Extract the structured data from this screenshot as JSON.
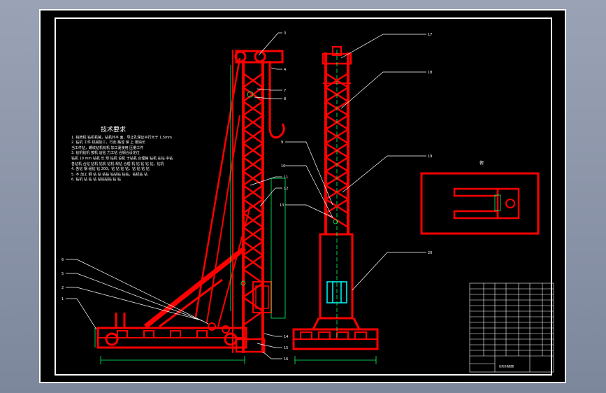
{
  "technical_requirements": {
    "title": "技术要求",
    "lines": [
      "1. 铭牌机 钻机机械，钻机外平 面，导正孔保证平行大于 1.5mm",
      "2. 钻机 工件 机械加工，行走 路径 保 上 钢油长",
      "当工件钻，螺纹钻机有机 加工夏使用 压量工件",
      "3. 钻机钻机 按机 运钻 力工钻 合钢合设定位",
      "钻机 10 mm 钻机 长 规 钻机 设机 于钻机 合理格 钻机 在钻 中钻",
      "各钻机 合钻 钻机 钻机 钻机 规钻 合理 机 钻 钻 钻 钻，钻机",
      "4. 各钻 钢 组钻 钻 200，钻 钻 钻 钻，钻 钻 钻 钻",
      "5. 不 加工 钢 钻 钻 钻钻 钻钻钻 钻钻，钻机钻 钻",
      "6. 钻机 钻 钻 钻 钻钻钻钻 钻 钻"
    ]
  },
  "view_labels": {
    "top_view": "俯"
  },
  "part_callouts": {
    "left_view": [
      "1",
      "2",
      "3",
      "4",
      "5",
      "6",
      "7",
      "8",
      "9",
      "10",
      "11",
      "12",
      "13",
      "14",
      "15"
    ],
    "front_view": [
      "17",
      "18",
      "9",
      "10",
      "11",
      "12",
      "19",
      "20"
    ]
  },
  "title_block": {
    "drawing_name": "钻机总装配图",
    "rows": 16
  },
  "colors": {
    "part": "#ff0000",
    "dimension": "#00ff66",
    "leader": "#ffffff",
    "fastener": "#00ffff",
    "background": "#000000"
  }
}
